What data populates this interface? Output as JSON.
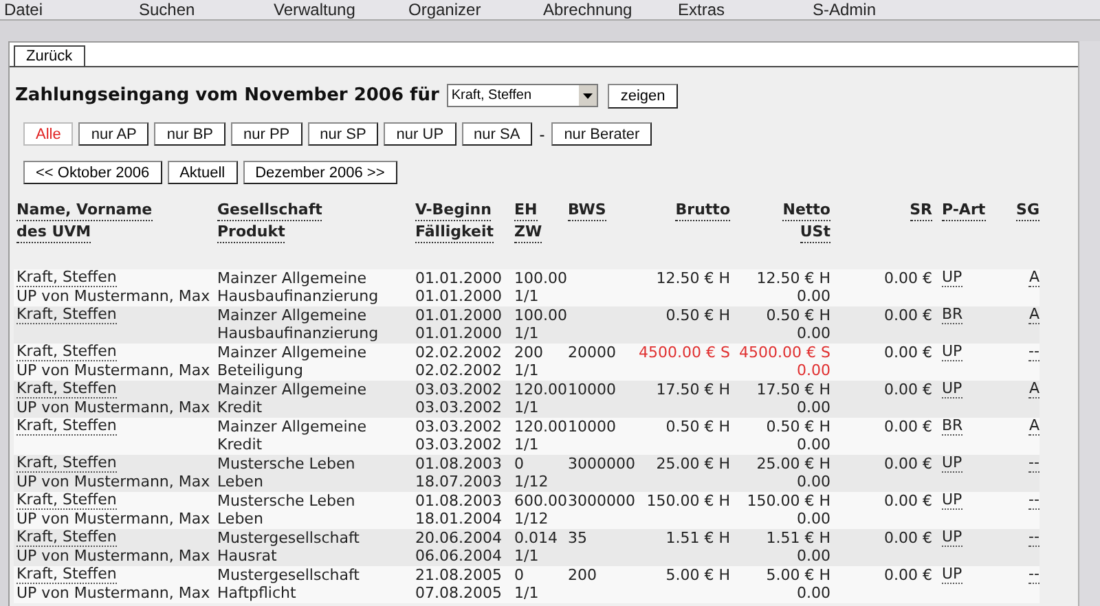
{
  "menu": [
    "Datei",
    "Suchen",
    "Verwaltung",
    "Organizer",
    "Abrechnung",
    "Extras",
    "S-Admin"
  ],
  "tab": "Zurück",
  "title": "Zahlungseingang vom November 2006 für",
  "select": {
    "value": "Kraft, Steffen"
  },
  "show_button": "zeigen",
  "filters": [
    {
      "label": "Alle",
      "selected": true
    },
    {
      "label": "nur AP",
      "selected": false
    },
    {
      "label": "nur BP",
      "selected": false
    },
    {
      "label": "nur PP",
      "selected": false
    },
    {
      "label": "nur SP",
      "selected": false
    },
    {
      "label": "nur UP",
      "selected": false
    },
    {
      "label": "nur SA",
      "selected": false
    }
  ],
  "separator": "-",
  "advisor_filter": {
    "label": "nur Berater",
    "selected": false
  },
  "month_nav": [
    "<< Oktober 2006",
    "Aktuell",
    "Dezember 2006 >>"
  ],
  "columns": [
    {
      "lines": [
        "Name, Vorname",
        "des UVM"
      ]
    },
    {
      "lines": [
        "Gesellschaft",
        "Produkt"
      ]
    },
    {
      "lines": [
        "V-Beginn",
        "Fälligkeit"
      ]
    },
    {
      "lines": [
        "EH",
        "ZW"
      ]
    },
    {
      "lines": [
        "BWS"
      ]
    },
    {
      "lines": [
        "Brutto"
      ]
    },
    {
      "lines": [
        "Netto",
        "USt"
      ]
    },
    {
      "lines": [
        "SR"
      ]
    },
    {
      "lines": [
        "P-Art"
      ]
    },
    {
      "lines": [
        "SG"
      ]
    }
  ],
  "rows": [
    {
      "name": "Kraft, Steffen",
      "uvm": "UP von Mustermann, Max",
      "gesellschaft": "Mainzer Allgemeine",
      "produkt": "Hausbaufinanzierung",
      "v_beginn": "01.01.2000",
      "faelligkeit": "01.01.2000",
      "eh": "100.00",
      "zw": "1/1",
      "brutto": "12.50 € H",
      "netto": "12.50 € H",
      "ust": "0.00",
      "sr": "0.00 €",
      "p_art": "UP",
      "sg": "A",
      "negative": false
    },
    {
      "name": "Kraft, Steffen",
      "gesellschaft": "Mainzer Allgemeine",
      "produkt": "Hausbaufinanzierung",
      "v_beginn": "01.01.2000",
      "faelligkeit": "01.01.2000",
      "eh": "100.00",
      "zw": "1/1",
      "brutto": "0.50 € H",
      "netto": "0.50 € H",
      "ust": "0.00",
      "sr": "0.00 €",
      "p_art": "BR",
      "sg": "A",
      "negative": false
    },
    {
      "name": "Kraft, Steffen",
      "uvm": "UP von Mustermann, Max",
      "gesellschaft": "Mainzer Allgemeine",
      "produkt": "Beteiligung",
      "v_beginn": "02.02.2002",
      "faelligkeit": "02.02.2002",
      "eh": "200",
      "zw": "1/1",
      "bws": "20000",
      "brutto": "4500.00 € S",
      "netto": "4500.00 € S",
      "ust": "0.00",
      "sr": "0.00 €",
      "p_art": "UP",
      "sg": "--",
      "negative": true
    },
    {
      "name": "Kraft, Steffen",
      "uvm": "UP von Mustermann, Max",
      "gesellschaft": "Mainzer Allgemeine",
      "produkt": "Kredit",
      "v_beginn": "03.03.2002",
      "faelligkeit": "03.03.2002",
      "eh": "120.00",
      "zw": "1/1",
      "bws": "10000",
      "brutto": "17.50 € H",
      "netto": "17.50 € H",
      "ust": "0.00",
      "sr": "0.00 €",
      "p_art": "UP",
      "sg": "A",
      "negative": false
    },
    {
      "name": "Kraft, Steffen",
      "gesellschaft": "Mainzer Allgemeine",
      "produkt": "Kredit",
      "v_beginn": "03.03.2002",
      "faelligkeit": "03.03.2002",
      "eh": "120.00",
      "zw": "1/1",
      "bws": "10000",
      "brutto": "0.50 € H",
      "netto": "0.50 € H",
      "ust": "0.00",
      "sr": "0.00 €",
      "p_art": "BR",
      "sg": "A",
      "negative": false
    },
    {
      "name": "Kraft, Steffen",
      "uvm": "UP von Mustermann, Max",
      "gesellschaft": "Mustersche Leben",
      "produkt": "Leben",
      "v_beginn": "01.08.2003",
      "faelligkeit": "18.07.2003",
      "eh": "0",
      "zw": "1/12",
      "bws": "3000000",
      "brutto": "25.00 € H",
      "netto": "25.00 € H",
      "ust": "0.00",
      "sr": "0.00 €",
      "p_art": "UP",
      "sg": "--",
      "negative": false
    },
    {
      "name": "Kraft, Steffen",
      "uvm": "UP von Mustermann, Max",
      "gesellschaft": "Mustersche Leben",
      "produkt": "Leben",
      "v_beginn": "01.08.2003",
      "faelligkeit": "18.01.2004",
      "eh": "600.00",
      "zw": "1/12",
      "bws": "3000000",
      "brutto": "150.00 € H",
      "netto": "150.00 € H",
      "ust": "0.00",
      "sr": "0.00 €",
      "p_art": "UP",
      "sg": "--",
      "negative": false
    },
    {
      "name": "Kraft, Steffen",
      "uvm": "UP von Mustermann, Max",
      "gesellschaft": "Mustergesellschaft",
      "produkt": "Hausrat",
      "v_beginn": "20.06.2004",
      "faelligkeit": "06.06.2004",
      "eh": "0.014",
      "zw": "1/1",
      "bws": "35",
      "brutto": "1.51 € H",
      "netto": "1.51 € H",
      "ust": "0.00",
      "sr": "0.00 €",
      "p_art": "UP",
      "sg": "--",
      "negative": false
    },
    {
      "name": "Kraft, Steffen",
      "uvm": "UP von Mustermann, Max",
      "gesellschaft": "Mustergesellschaft",
      "produkt": "Haftpflicht",
      "v_beginn": "21.08.2005",
      "faelligkeit": "07.08.2005",
      "eh": "0",
      "zw": "1/1",
      "bws": "200",
      "brutto": "5.00 € H",
      "netto": "5.00 € H",
      "ust": "0.00",
      "sr": "0.00 €",
      "p_art": "UP",
      "sg": "--",
      "negative": false
    }
  ]
}
